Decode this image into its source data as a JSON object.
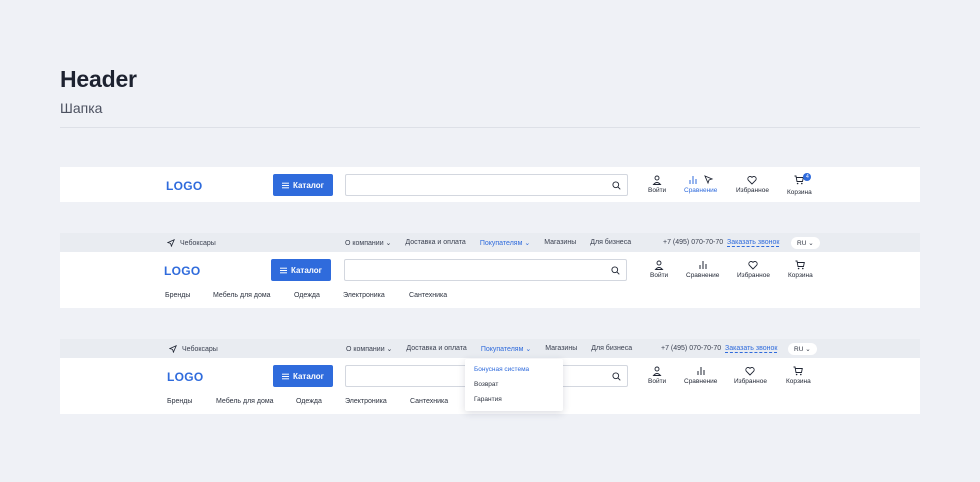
{
  "header": {
    "title": "Header",
    "subtitle": "Шапка"
  },
  "logo": "LOGO",
  "catalog_label": "Каталог",
  "city": "Чебоксары",
  "top_nav": [
    "О компании",
    "Доставка и оплата",
    "Покупателям",
    "Магазины",
    "Для бизнеса"
  ],
  "phone": "+7 (495) 070-70-70",
  "callback": "Заказать звонок",
  "lang": "RU",
  "actions": {
    "login": "Войти",
    "compare": "Сравнение",
    "favorites": "Избранное",
    "cart": "Корзина"
  },
  "cart_count": "4",
  "categories": [
    "Бренды",
    "Мебель для дома",
    "Одежда",
    "Электроника",
    "Сантехника"
  ],
  "dropdown": [
    "Бонусная система",
    "Возврат",
    "Гарантия"
  ],
  "colors": {
    "accent": "#2f6bdc",
    "background": "#eff1f6"
  }
}
